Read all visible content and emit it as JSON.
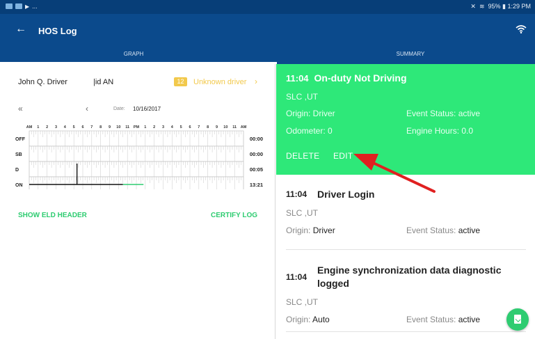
{
  "status_bar": {
    "left_glyph": "...",
    "right_text": "95% ▮ 1:29 PM"
  },
  "app_bar": {
    "back_icon": "arrow-left-icon",
    "title": "HOS Log",
    "wifi_icon": "wifi-icon"
  },
  "tabs": [
    {
      "label": "GRAPH",
      "selected": true
    },
    {
      "label": "SUMMARY",
      "selected": false
    }
  ],
  "graph": {
    "driver_name": "John Q. Driver",
    "driver_id": "|id AN",
    "unknown_count": "12",
    "unknown_label": "Unknown driver",
    "unknown_chevron": "›",
    "nav_first": "«",
    "nav_prev": "‹",
    "date_label": "Date:",
    "date_value": "10/16/2017",
    "hour_labels": [
      "AM",
      "1",
      "2",
      "3",
      "4",
      "5",
      "6",
      "7",
      "8",
      "9",
      "10",
      "11",
      "PM",
      "1",
      "2",
      "3",
      "4",
      "5",
      "6",
      "7",
      "8",
      "9",
      "10",
      "11",
      "AM"
    ],
    "rows": [
      {
        "label": "OFF",
        "total": "00:00"
      },
      {
        "label": "SB",
        "total": "00:00"
      },
      {
        "label": "D",
        "total": "00:05"
      },
      {
        "label": "ON",
        "total": "13:21"
      }
    ],
    "show_eld_header": "SHOW ELD HEADER",
    "certify_log": "CERTIFY LOG"
  },
  "selected_event": {
    "time": "11:04",
    "title": "On-duty Not Driving",
    "location": "SLC ,UT",
    "origin": "Origin: Driver",
    "event_status": "Event Status: active",
    "odometer": "Odometer: 0",
    "engine_hours": "Engine Hours: 0.0",
    "delete_label": "DELETE",
    "edit_label": "EDIT",
    "background": "#2ee879"
  },
  "events": [
    {
      "time": "11:04",
      "title": "Driver Login",
      "location": "SLC ,UT",
      "origin_label": "Origin:",
      "origin_value": "Driver",
      "status_label": "Event Status:",
      "status_value": "active"
    },
    {
      "time": "11:04",
      "title_line1": "Engine synchronization data diagnostic",
      "title_line2": "logged",
      "location": "SLC ,UT",
      "origin_label": "Origin:",
      "origin_value": "Auto",
      "status_label": "Event Status:",
      "status_value": "active"
    }
  ],
  "fab": {
    "icon": "document-check-icon"
  },
  "colors": {
    "header_blue": "#0b4a8c",
    "accent_green": "#2ecc71",
    "warning_yellow": "#f2c94c",
    "annotation_red": "#e02020"
  }
}
